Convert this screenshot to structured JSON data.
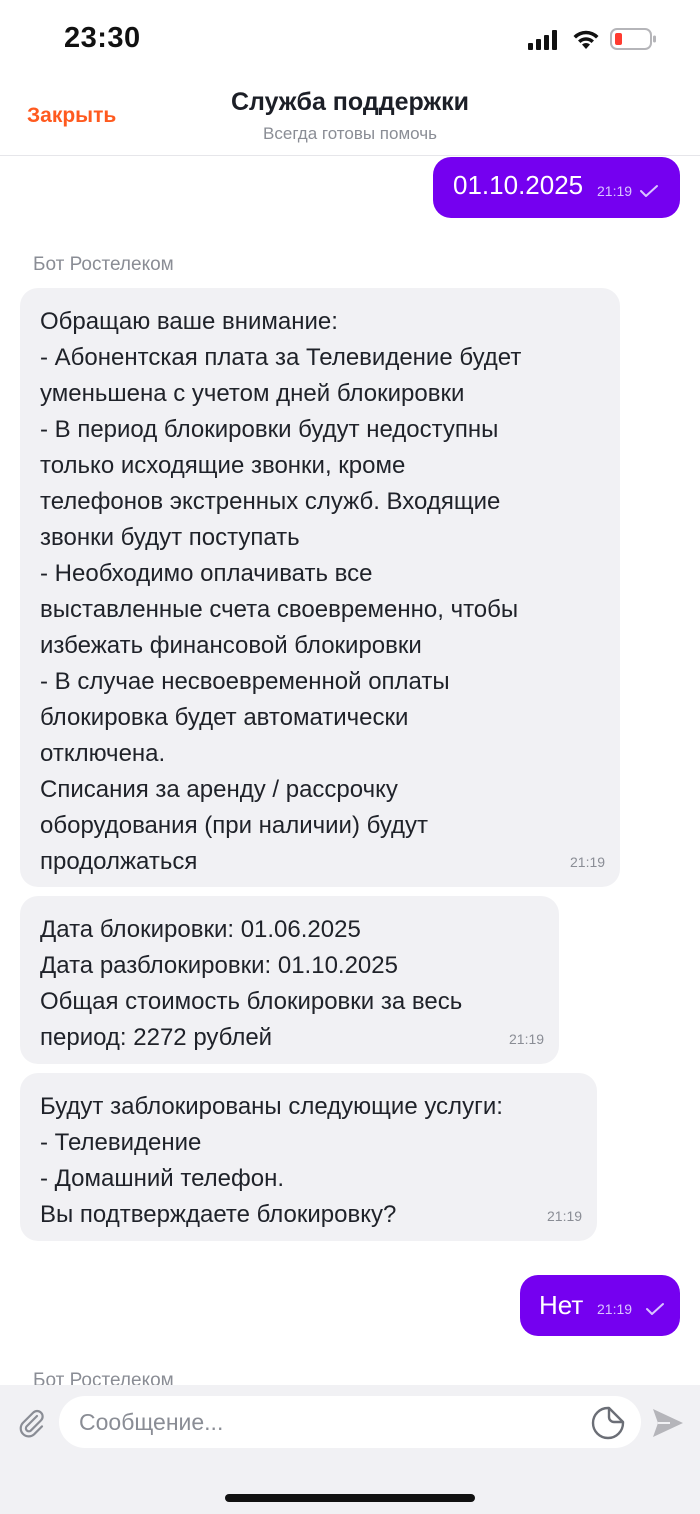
{
  "status_bar": {
    "time": "23:30"
  },
  "header": {
    "close_label": "Закрыть",
    "title": "Служба поддержки",
    "subtitle": "Всегда готовы помочь"
  },
  "messages": {
    "out1": {
      "text": "01.10.2025",
      "time": "21:19"
    },
    "sender1": "Бот Ростелеком",
    "in1": {
      "lines": [
        "Обращаю ваше внимание:",
        "- Абонентская плата за Телевидение будет",
        "уменьшена с учетом дней блокировки",
        "- В период блокировки будут недоступны",
        "только исходящие звонки, кроме",
        "телефонов экстренных служб. Входящие",
        "звонки будут поступать",
        "- Необходимо оплачивать все",
        "выставленные счета своевременно, чтобы",
        "избежать финансовой блокировки",
        "- В случае несвоевременной оплаты",
        "блокировка будет автоматически",
        "отключена.",
        "Списания за аренду / рассрочку",
        "оборудования (при наличии) будут",
        "продолжаться"
      ],
      "time": "21:19"
    },
    "in2": {
      "lines": [
        "Дата блокировки: 01.06.2025",
        "Дата разблокировки: 01.10.2025",
        "Общая стоимость блокировки за весь",
        "период: 2272 рублей"
      ],
      "time": "21:19"
    },
    "in3": {
      "lines": [
        "Будут заблокированы следующие услуги:",
        "- Телевидение",
        "- Домашний телефон.",
        "Вы подтверждаете блокировку?"
      ],
      "time": "21:19"
    },
    "out2": {
      "text": "Нет",
      "time": "21:19"
    },
    "sender2": "Бот Ростелеком"
  },
  "input_bar": {
    "placeholder": "Сообщение..."
  },
  "colors": {
    "accent": "#7500f0",
    "close": "#ff5a1f",
    "bubble_in": "#f1f1f4"
  },
  "icons": [
    "signal-icon",
    "wifi-icon",
    "battery-icon",
    "checkmark-icon",
    "paperclip-icon",
    "sticker-icon",
    "send-icon"
  ]
}
